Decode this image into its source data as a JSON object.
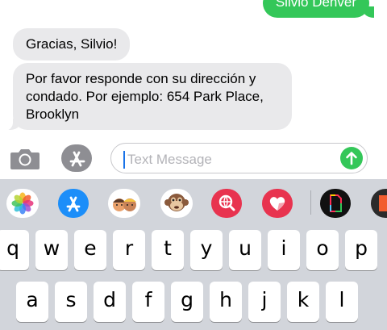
{
  "conversation": {
    "messages": [
      {
        "direction": "outgoing",
        "text": "Silvio Denver"
      },
      {
        "direction": "incoming",
        "text": "Gracias, Silvio!"
      },
      {
        "direction": "incoming",
        "lines": [
          "Por favor responde con su dirección y",
          "condado. Por ejemplo: 654 Park Place,",
          "Brooklyn"
        ]
      }
    ]
  },
  "composer": {
    "placeholder": "Text Message",
    "camera_icon": "camera-icon",
    "apps_icon": "app-store-icon",
    "send_icon": "send-arrow-icon"
  },
  "app_strip": [
    {
      "name": "photos-app-icon"
    },
    {
      "name": "app-store-app-icon"
    },
    {
      "name": "memoji-stickers-app-icon"
    },
    {
      "name": "animoji-monkey-app-icon"
    },
    {
      "name": "web-images-search-app-icon"
    },
    {
      "name": "digital-touch-heart-app-icon"
    },
    {
      "name": "document-app-icon"
    },
    {
      "name": "partial-app-icon"
    }
  ],
  "keyboard": {
    "row1": [
      "q",
      "w",
      "e",
      "r",
      "t",
      "y",
      "u",
      "i",
      "o",
      "p"
    ],
    "row2": [
      "a",
      "s",
      "d",
      "f",
      "g",
      "h",
      "j",
      "k",
      "l"
    ]
  },
  "colors": {
    "outgoing_bubble": "#34c759",
    "incoming_bubble": "#e9e9eb",
    "keyboard_bg": "#d2d5db",
    "send_button": "#34c759"
  }
}
